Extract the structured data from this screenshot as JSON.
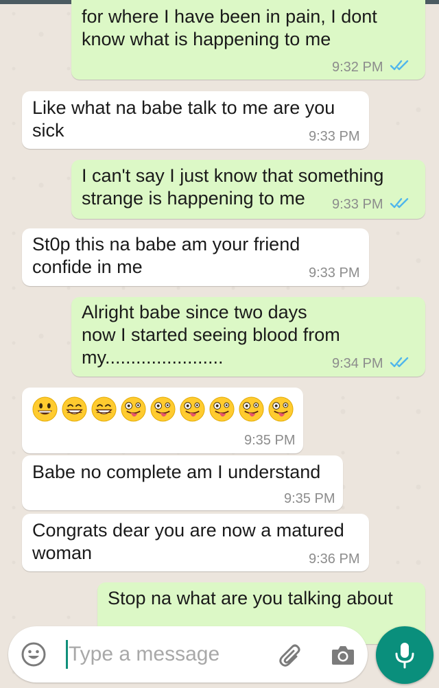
{
  "messages": [
    {
      "text": "for where I have been in pain, I dont\nknow what is happening to me",
      "time": "9:32 PM"
    },
    {
      "text": "Like what na babe talk to me are you\nsick",
      "time": "9:33 PM"
    },
    {
      "text": "I can't say I just know that something\nstrange is happening to me",
      "time": "9:33 PM"
    },
    {
      "text": "St0p this na babe am your friend\nconfide in me",
      "time": "9:33 PM"
    },
    {
      "text": "Alright babe since two days\nnow I started seeing blood from\nmy.......................",
      "time": "9:34 PM"
    },
    {
      "time": "9:35 PM",
      "emojis": [
        "grinning-face",
        "beaming-face",
        "beaming-face",
        "zany-face",
        "zany-face",
        "zany-face",
        "zany-face",
        "zany-face",
        "zany-face"
      ]
    },
    {
      "text": "Babe no complete am I understand",
      "time": "9:35 PM"
    },
    {
      "text": "Congrats dear you are now a matured\nwoman",
      "time": "9:36 PM"
    },
    {
      "text": "Stop na what are you talking about"
    }
  ],
  "composer": {
    "placeholder": "Type a message",
    "icons": [
      "emoji-icon",
      "paperclip-icon",
      "camera-icon",
      "microphone-icon"
    ]
  },
  "colors": {
    "outgoing_bubble": "#dcf8c6",
    "incoming_bubble": "#ffffff",
    "chat_background": "#ece5dd",
    "read_ticks": "#4fb6ec",
    "mic_button": "#0a8f7c"
  }
}
